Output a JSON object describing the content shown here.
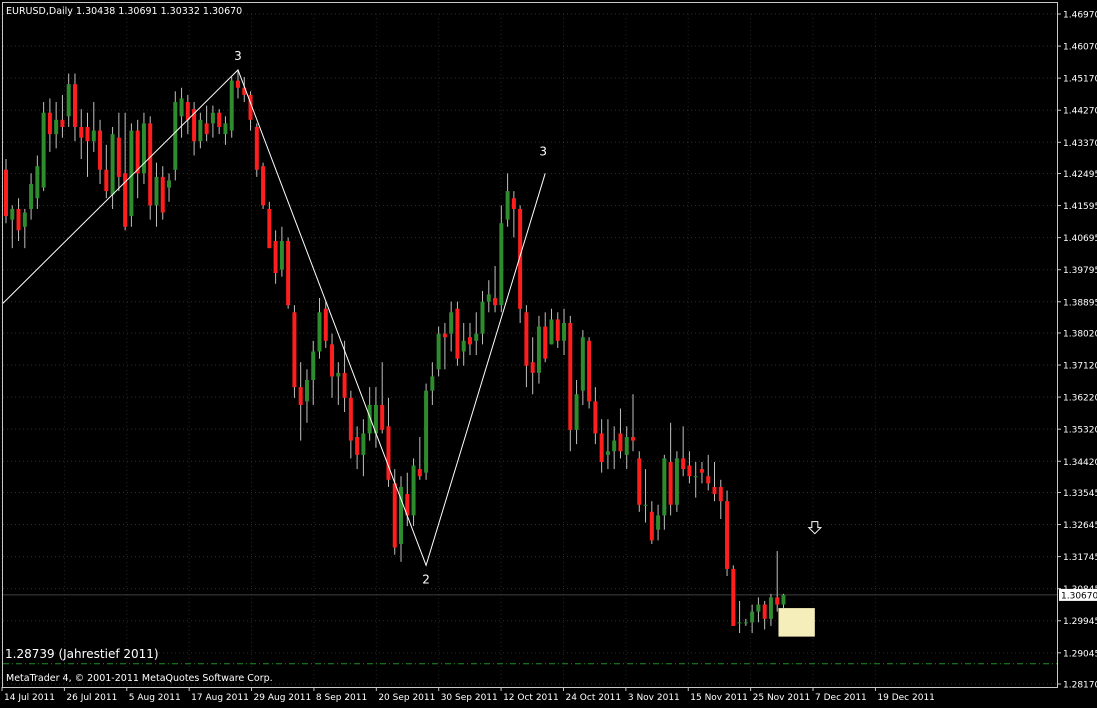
{
  "header": {
    "symbol": "EURUSD,Daily",
    "ohlc": "1.30438 1.30691 1.30332 1.30670"
  },
  "footer": {
    "copyright": "MetaTrader 4, © 2001-2011 MetaQuotes Software Corp."
  },
  "annotation_low": "1.28739 (Jahrestief 2011)",
  "colors": {
    "background": "#000000",
    "up_candle": "#2e8b2e",
    "down_candle": "#ff1e1e",
    "wick": "#c0c0c0",
    "wave_line": "#ffffff",
    "grid": "#ffffff",
    "low_line": "#1f8f1f",
    "highlight_box": "#f5eebb"
  },
  "chart_data": {
    "type": "candlestick",
    "instrument": "EURUSD",
    "timeframe": "Daily",
    "ylim": [
      1.2817,
      1.4697
    ],
    "y_ticks": [
      "1.46970",
      "1.46070",
      "1.45170",
      "1.44270",
      "1.43370",
      "1.42495",
      "1.41595",
      "1.40695",
      "1.39795",
      "1.38895",
      "1.38020",
      "1.37120",
      "1.36220",
      "1.35320",
      "1.34420",
      "1.33545",
      "1.32645",
      "1.31745",
      "1.30845",
      "1.29945",
      "1.29045",
      "1.28170"
    ],
    "x_ticks": [
      "14 Jul 2011",
      "26 Jul 2011",
      "5 Aug 2011",
      "17 Aug 2011",
      "29 Aug 2011",
      "8 Sep 2011",
      "20 Sep 2011",
      "30 Sep 2011",
      "12 Oct 2011",
      "24 Oct 2011",
      "3 Nov 2011",
      "15 Nov 2011",
      "25 Nov 2011",
      "7 Dec 2011",
      "19 Dec 2011"
    ],
    "current_price": "1.30670",
    "year_low": 1.28739,
    "candles": [
      {
        "o": 1.426,
        "h": 1.429,
        "l": 1.411,
        "c": 1.413
      },
      {
        "o": 1.412,
        "h": 1.416,
        "l": 1.404,
        "c": 1.415
      },
      {
        "o": 1.415,
        "h": 1.418,
        "l": 1.406,
        "c": 1.409
      },
      {
        "o": 1.41,
        "h": 1.415,
        "l": 1.404,
        "c": 1.414
      },
      {
        "o": 1.415,
        "h": 1.425,
        "l": 1.412,
        "c": 1.422
      },
      {
        "o": 1.418,
        "h": 1.43,
        "l": 1.415,
        "c": 1.427
      },
      {
        "o": 1.421,
        "h": 1.445,
        "l": 1.42,
        "c": 1.442
      },
      {
        "o": 1.442,
        "h": 1.446,
        "l": 1.431,
        "c": 1.436
      },
      {
        "o": 1.436,
        "h": 1.445,
        "l": 1.432,
        "c": 1.44
      },
      {
        "o": 1.44,
        "h": 1.447,
        "l": 1.435,
        "c": 1.438
      },
      {
        "o": 1.441,
        "h": 1.453,
        "l": 1.438,
        "c": 1.45
      },
      {
        "o": 1.45,
        "h": 1.453,
        "l": 1.434,
        "c": 1.438
      },
      {
        "o": 1.438,
        "h": 1.443,
        "l": 1.429,
        "c": 1.435
      },
      {
        "o": 1.438,
        "h": 1.442,
        "l": 1.424,
        "c": 1.434
      },
      {
        "o": 1.434,
        "h": 1.445,
        "l": 1.431,
        "c": 1.437
      },
      {
        "o": 1.437,
        "h": 1.44,
        "l": 1.422,
        "c": 1.426
      },
      {
        "o": 1.426,
        "h": 1.433,
        "l": 1.418,
        "c": 1.42
      },
      {
        "o": 1.419,
        "h": 1.438,
        "l": 1.415,
        "c": 1.436
      },
      {
        "o": 1.435,
        "h": 1.442,
        "l": 1.42,
        "c": 1.424
      },
      {
        "o": 1.425,
        "h": 1.442,
        "l": 1.409,
        "c": 1.41
      },
      {
        "o": 1.413,
        "h": 1.439,
        "l": 1.41,
        "c": 1.437
      },
      {
        "o": 1.437,
        "h": 1.44,
        "l": 1.418,
        "c": 1.425
      },
      {
        "o": 1.425,
        "h": 1.442,
        "l": 1.422,
        "c": 1.439
      },
      {
        "o": 1.439,
        "h": 1.441,
        "l": 1.412,
        "c": 1.416
      },
      {
        "o": 1.416,
        "h": 1.428,
        "l": 1.41,
        "c": 1.424
      },
      {
        "o": 1.424,
        "h": 1.427,
        "l": 1.412,
        "c": 1.414
      },
      {
        "o": 1.421,
        "h": 1.425,
        "l": 1.417,
        "c": 1.423
      },
      {
        "o": 1.426,
        "h": 1.448,
        "l": 1.423,
        "c": 1.445
      },
      {
        "o": 1.441,
        "h": 1.449,
        "l": 1.435,
        "c": 1.446
      },
      {
        "o": 1.445,
        "h": 1.447,
        "l": 1.436,
        "c": 1.44
      },
      {
        "o": 1.443,
        "h": 1.445,
        "l": 1.43,
        "c": 1.434
      },
      {
        "o": 1.434,
        "h": 1.442,
        "l": 1.432,
        "c": 1.44
      },
      {
        "o": 1.439,
        "h": 1.444,
        "l": 1.434,
        "c": 1.436
      },
      {
        "o": 1.439,
        "h": 1.444,
        "l": 1.435,
        "c": 1.442
      },
      {
        "o": 1.442,
        "h": 1.443,
        "l": 1.436,
        "c": 1.438
      },
      {
        "o": 1.436,
        "h": 1.441,
        "l": 1.433,
        "c": 1.439
      },
      {
        "o": 1.437,
        "h": 1.452,
        "l": 1.435,
        "c": 1.451
      },
      {
        "o": 1.451,
        "h": 1.454,
        "l": 1.446,
        "c": 1.449
      },
      {
        "o": 1.449,
        "h": 1.452,
        "l": 1.445,
        "c": 1.447
      },
      {
        "o": 1.447,
        "h": 1.448,
        "l": 1.437,
        "c": 1.44
      },
      {
        "o": 1.438,
        "h": 1.439,
        "l": 1.424,
        "c": 1.426
      },
      {
        "o": 1.427,
        "h": 1.428,
        "l": 1.415,
        "c": 1.416
      },
      {
        "o": 1.415,
        "h": 1.417,
        "l": 1.404,
        "c": 1.404
      },
      {
        "o": 1.406,
        "h": 1.409,
        "l": 1.394,
        "c": 1.397
      },
      {
        "o": 1.398,
        "h": 1.41,
        "l": 1.396,
        "c": 1.406
      },
      {
        "o": 1.406,
        "h": 1.407,
        "l": 1.387,
        "c": 1.388
      },
      {
        "o": 1.386,
        "h": 1.388,
        "l": 1.362,
        "c": 1.365
      },
      {
        "o": 1.365,
        "h": 1.372,
        "l": 1.35,
        "c": 1.36
      },
      {
        "o": 1.361,
        "h": 1.37,
        "l": 1.355,
        "c": 1.367
      },
      {
        "o": 1.367,
        "h": 1.378,
        "l": 1.36,
        "c": 1.375
      },
      {
        "o": 1.375,
        "h": 1.39,
        "l": 1.373,
        "c": 1.386
      },
      {
        "o": 1.387,
        "h": 1.389,
        "l": 1.376,
        "c": 1.378
      },
      {
        "o": 1.377,
        "h": 1.38,
        "l": 1.362,
        "c": 1.368
      },
      {
        "o": 1.368,
        "h": 1.372,
        "l": 1.36,
        "c": 1.369
      },
      {
        "o": 1.369,
        "h": 1.378,
        "l": 1.358,
        "c": 1.362
      },
      {
        "o": 1.362,
        "h": 1.364,
        "l": 1.345,
        "c": 1.35
      },
      {
        "o": 1.351,
        "h": 1.354,
        "l": 1.342,
        "c": 1.346
      },
      {
        "o": 1.346,
        "h": 1.356,
        "l": 1.34,
        "c": 1.352
      },
      {
        "o": 1.352,
        "h": 1.365,
        "l": 1.35,
        "c": 1.36
      },
      {
        "o": 1.352,
        "h": 1.365,
        "l": 1.348,
        "c": 1.36
      },
      {
        "o": 1.36,
        "h": 1.372,
        "l": 1.352,
        "c": 1.353
      },
      {
        "o": 1.354,
        "h": 1.362,
        "l": 1.337,
        "c": 1.339
      },
      {
        "o": 1.338,
        "h": 1.342,
        "l": 1.318,
        "c": 1.32
      },
      {
        "o": 1.321,
        "h": 1.34,
        "l": 1.316,
        "c": 1.337
      },
      {
        "o": 1.335,
        "h": 1.341,
        "l": 1.326,
        "c": 1.329
      },
      {
        "o": 1.329,
        "h": 1.345,
        "l": 1.326,
        "c": 1.343
      },
      {
        "o": 1.342,
        "h": 1.351,
        "l": 1.339,
        "c": 1.34
      },
      {
        "o": 1.341,
        "h": 1.366,
        "l": 1.339,
        "c": 1.364
      },
      {
        "o": 1.364,
        "h": 1.372,
        "l": 1.36,
        "c": 1.368
      },
      {
        "o": 1.37,
        "h": 1.382,
        "l": 1.368,
        "c": 1.38
      },
      {
        "o": 1.38,
        "h": 1.383,
        "l": 1.37,
        "c": 1.379
      },
      {
        "o": 1.38,
        "h": 1.389,
        "l": 1.375,
        "c": 1.386
      },
      {
        "o": 1.387,
        "h": 1.389,
        "l": 1.371,
        "c": 1.373
      },
      {
        "o": 1.375,
        "h": 1.383,
        "l": 1.371,
        "c": 1.378
      },
      {
        "o": 1.379,
        "h": 1.383,
        "l": 1.374,
        "c": 1.377
      },
      {
        "o": 1.378,
        "h": 1.386,
        "l": 1.374,
        "c": 1.38
      },
      {
        "o": 1.38,
        "h": 1.392,
        "l": 1.377,
        "c": 1.389
      },
      {
        "o": 1.389,
        "h": 1.395,
        "l": 1.386,
        "c": 1.391
      },
      {
        "o": 1.39,
        "h": 1.399,
        "l": 1.386,
        "c": 1.388
      },
      {
        "o": 1.388,
        "h": 1.416,
        "l": 1.386,
        "c": 1.411
      },
      {
        "o": 1.412,
        "h": 1.425,
        "l": 1.41,
        "c": 1.42
      },
      {
        "o": 1.418,
        "h": 1.42,
        "l": 1.407,
        "c": 1.415
      },
      {
        "o": 1.415,
        "h": 1.416,
        "l": 1.383,
        "c": 1.387
      },
      {
        "o": 1.386,
        "h": 1.388,
        "l": 1.365,
        "c": 1.371
      },
      {
        "o": 1.372,
        "h": 1.379,
        "l": 1.363,
        "c": 1.369
      },
      {
        "o": 1.369,
        "h": 1.385,
        "l": 1.366,
        "c": 1.382
      },
      {
        "o": 1.382,
        "h": 1.386,
        "l": 1.372,
        "c": 1.373
      },
      {
        "o": 1.377,
        "h": 1.387,
        "l": 1.377,
        "c": 1.384
      },
      {
        "o": 1.384,
        "h": 1.386,
        "l": 1.376,
        "c": 1.378
      },
      {
        "o": 1.378,
        "h": 1.387,
        "l": 1.374,
        "c": 1.383
      },
      {
        "o": 1.383,
        "h": 1.385,
        "l": 1.347,
        "c": 1.353
      },
      {
        "o": 1.353,
        "h": 1.367,
        "l": 1.349,
        "c": 1.363
      },
      {
        "o": 1.364,
        "h": 1.381,
        "l": 1.36,
        "c": 1.379
      },
      {
        "o": 1.378,
        "h": 1.379,
        "l": 1.359,
        "c": 1.361
      },
      {
        "o": 1.361,
        "h": 1.365,
        "l": 1.349,
        "c": 1.352
      },
      {
        "o": 1.352,
        "h": 1.356,
        "l": 1.341,
        "c": 1.344
      },
      {
        "o": 1.346,
        "h": 1.356,
        "l": 1.342,
        "c": 1.347
      },
      {
        "o": 1.347,
        "h": 1.354,
        "l": 1.342,
        "c": 1.35
      },
      {
        "o": 1.352,
        "h": 1.359,
        "l": 1.345,
        "c": 1.347
      },
      {
        "o": 1.346,
        "h": 1.354,
        "l": 1.342,
        "c": 1.351
      },
      {
        "o": 1.351,
        "h": 1.363,
        "l": 1.347,
        "c": 1.35
      },
      {
        "o": 1.345,
        "h": 1.347,
        "l": 1.33,
        "c": 1.332
      },
      {
        "o": 1.332,
        "h": 1.342,
        "l": 1.327,
        "c": 1.332
      },
      {
        "o": 1.33,
        "h": 1.333,
        "l": 1.321,
        "c": 1.322
      },
      {
        "o": 1.325,
        "h": 1.332,
        "l": 1.322,
        "c": 1.329
      },
      {
        "o": 1.329,
        "h": 1.346,
        "l": 1.325,
        "c": 1.345
      },
      {
        "o": 1.344,
        "h": 1.355,
        "l": 1.329,
        "c": 1.332
      },
      {
        "o": 1.332,
        "h": 1.347,
        "l": 1.33,
        "c": 1.345
      },
      {
        "o": 1.345,
        "h": 1.354,
        "l": 1.34,
        "c": 1.342
      },
      {
        "o": 1.343,
        "h": 1.347,
        "l": 1.338,
        "c": 1.34
      },
      {
        "o": 1.34,
        "h": 1.344,
        "l": 1.334,
        "c": 1.34
      },
      {
        "o": 1.342,
        "h": 1.344,
        "l": 1.338,
        "c": 1.341
      },
      {
        "o": 1.34,
        "h": 1.346,
        "l": 1.336,
        "c": 1.338
      },
      {
        "o": 1.337,
        "h": 1.344,
        "l": 1.333,
        "c": 1.335
      },
      {
        "o": 1.337,
        "h": 1.339,
        "l": 1.328,
        "c": 1.333
      },
      {
        "o": 1.333,
        "h": 1.336,
        "l": 1.312,
        "c": 1.314
      },
      {
        "o": 1.314,
        "h": 1.315,
        "l": 1.298,
        "c": 1.298
      },
      {
        "o": 1.299,
        "h": 1.305,
        "l": 1.296,
        "c": 1.299
      },
      {
        "o": 1.299,
        "h": 1.3,
        "l": 1.298,
        "c": 1.299
      },
      {
        "o": 1.299,
        "h": 1.304,
        "l": 1.296,
        "c": 1.302
      },
      {
        "o": 1.302,
        "h": 1.306,
        "l": 1.299,
        "c": 1.304
      },
      {
        "o": 1.304,
        "h": 1.305,
        "l": 1.297,
        "c": 1.3
      },
      {
        "o": 1.3,
        "h": 1.307,
        "l": 1.298,
        "c": 1.306
      },
      {
        "o": 1.306,
        "h": 1.319,
        "l": 1.302,
        "c": 1.304
      },
      {
        "o": 1.304,
        "h": 1.307,
        "l": 1.303,
        "c": 1.3067
      }
    ],
    "wave_labels": [
      "3",
      "2",
      "3"
    ],
    "wave_points": [
      {
        "i": -0.5,
        "price": 1.3885
      },
      {
        "i": 37,
        "price": 1.454
      },
      {
        "i": 67,
        "price": 1.315
      },
      {
        "i": 86,
        "price": 1.425
      }
    ],
    "highlight": {
      "from": 124,
      "to": 129
    },
    "arrow_at": 129
  }
}
